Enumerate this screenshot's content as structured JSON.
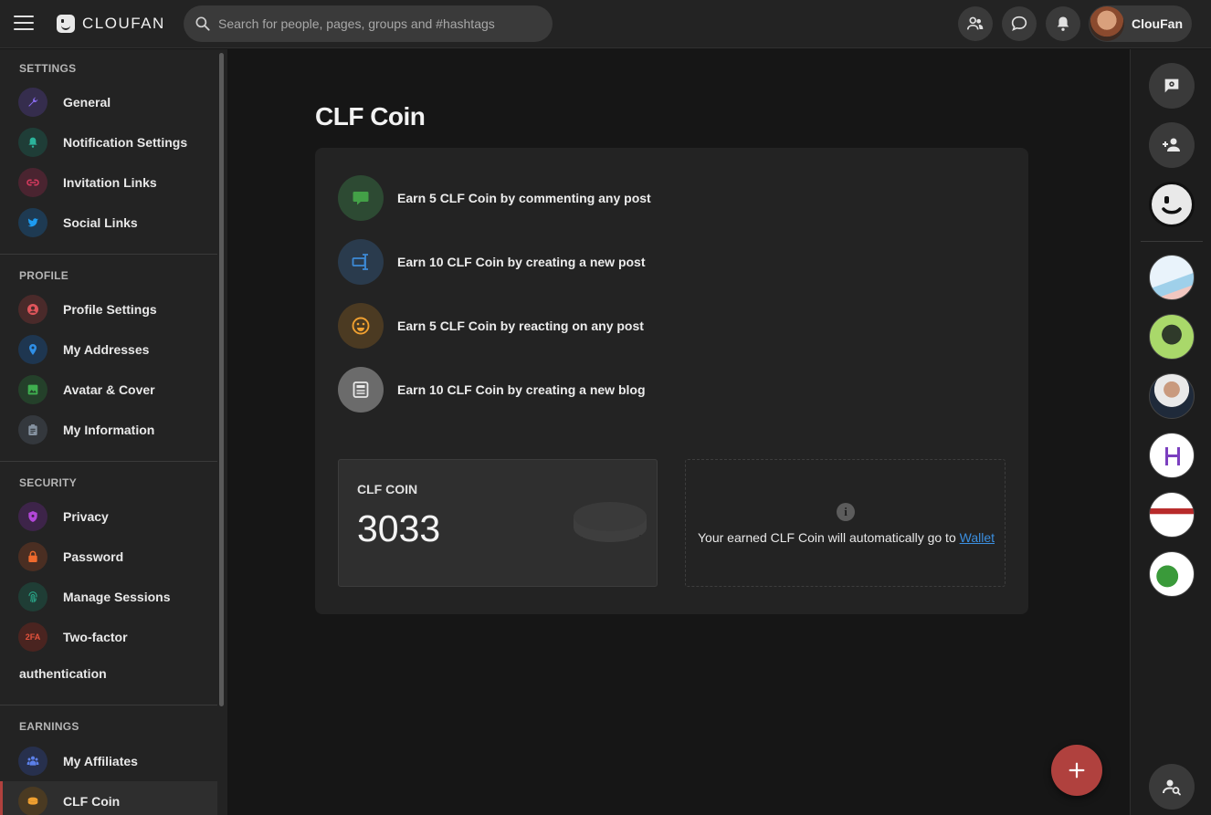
{
  "header": {
    "logo_text": "CLOUFAN",
    "search_placeholder": "Search for people, pages, groups and #hashtags",
    "user_name": "ClouFan"
  },
  "sidebar": {
    "sections": [
      {
        "title": "SETTINGS",
        "items": [
          "General",
          "Notification Settings",
          "Invitation Links",
          "Social Links"
        ]
      },
      {
        "title": "PROFILE",
        "items": [
          "Profile Settings",
          "My Addresses",
          "Avatar & Cover",
          "My Information"
        ]
      },
      {
        "title": "SECURITY",
        "items": [
          "Privacy",
          "Password",
          "Manage Sessions",
          "Two-factor",
          "authentication"
        ]
      },
      {
        "title": "EARNINGS",
        "items": [
          "My Affiliates",
          "CLF Coin"
        ]
      }
    ],
    "active_item": "CLF Coin",
    "icon_2fa_text": "2FA"
  },
  "main": {
    "title": "CLF Coin",
    "earn_rules": [
      {
        "text": "Earn 5 CLF Coin by commenting any post",
        "icon": "comment-icon",
        "bg": "#2d4a33",
        "fg": "#43a047"
      },
      {
        "text": "Earn 10 CLF Coin by creating a new post",
        "icon": "post-icon",
        "bg": "#2a3b4d",
        "fg": "#3d8ad6"
      },
      {
        "text": "Earn 5 CLF Coin by reacting on any post",
        "icon": "smile-icon",
        "bg": "#4b3a22",
        "fg": "#f0a030"
      },
      {
        "text": "Earn 10 CLF Coin by creating a new blog",
        "icon": "blog-icon",
        "bg": "#6b6b6b",
        "fg": "#e8e8e8"
      }
    ],
    "coin_label": "CLF COIN",
    "coin_value": "3033",
    "wallet_text": "Your earned CLF Coin will automatically go to ",
    "wallet_link": "Wallet"
  },
  "colors": {
    "accent": "#b0413e",
    "link": "#3b8fe0"
  }
}
